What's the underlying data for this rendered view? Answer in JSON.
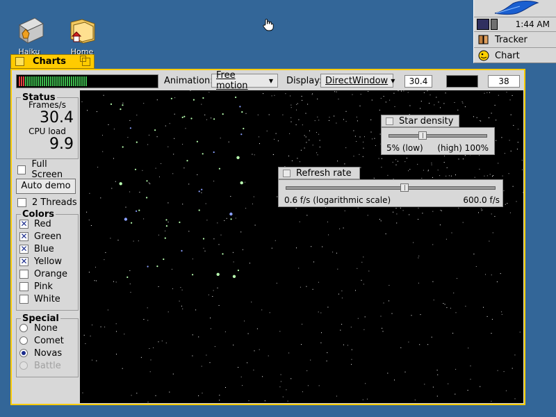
{
  "desktop": {
    "icons": [
      {
        "label": "Haiku"
      },
      {
        "label": "Home"
      }
    ]
  },
  "deskbar": {
    "clock": "1:44 AM",
    "apps": [
      {
        "label": "Tracker"
      },
      {
        "label": "Chart"
      }
    ]
  },
  "window": {
    "title": "Charts",
    "toolbar": {
      "animation_label": "Animation:",
      "animation_value": "Free motion",
      "display_label": "Display:",
      "display_value": "DirectWindow",
      "fps_box": "30.4",
      "count_box": "38"
    },
    "status": {
      "legend": "Status",
      "frames_label": "Frames/s",
      "frames_value": "30.4",
      "cpu_label": "CPU load",
      "cpu_value": "9.9"
    },
    "full_screen": {
      "label": "Full Screen",
      "checked": false
    },
    "auto_demo": "Auto demo",
    "two_threads": {
      "label": "2 Threads",
      "checked": false
    },
    "colors": {
      "legend": "Colors",
      "items": [
        {
          "label": "Red",
          "checked": true
        },
        {
          "label": "Green",
          "checked": true
        },
        {
          "label": "Blue",
          "checked": true
        },
        {
          "label": "Yellow",
          "checked": true
        },
        {
          "label": "Orange",
          "checked": false
        },
        {
          "label": "Pink",
          "checked": false
        },
        {
          "label": "White",
          "checked": false
        }
      ]
    },
    "special": {
      "legend": "Special",
      "items": [
        {
          "label": "None",
          "selected": false,
          "disabled": false
        },
        {
          "label": "Comet",
          "selected": false,
          "disabled": false
        },
        {
          "label": "Novas",
          "selected": true,
          "disabled": false
        },
        {
          "label": "Battle",
          "selected": false,
          "disabled": true
        }
      ]
    }
  },
  "star_density": {
    "title": "Star density",
    "min_label": "5% (low)",
    "max_label": "(high) 100%",
    "value_fraction": 0.35
  },
  "refresh_rate": {
    "title": "Refresh rate",
    "min_label": "0.6 f/s  (logarithmic scale)",
    "max_label": "600.0 f/s",
    "value_fraction": 0.57
  },
  "colors": {
    "desktop": "#336698",
    "window_tab": "#ffcb00",
    "star_bg": "#000000"
  }
}
